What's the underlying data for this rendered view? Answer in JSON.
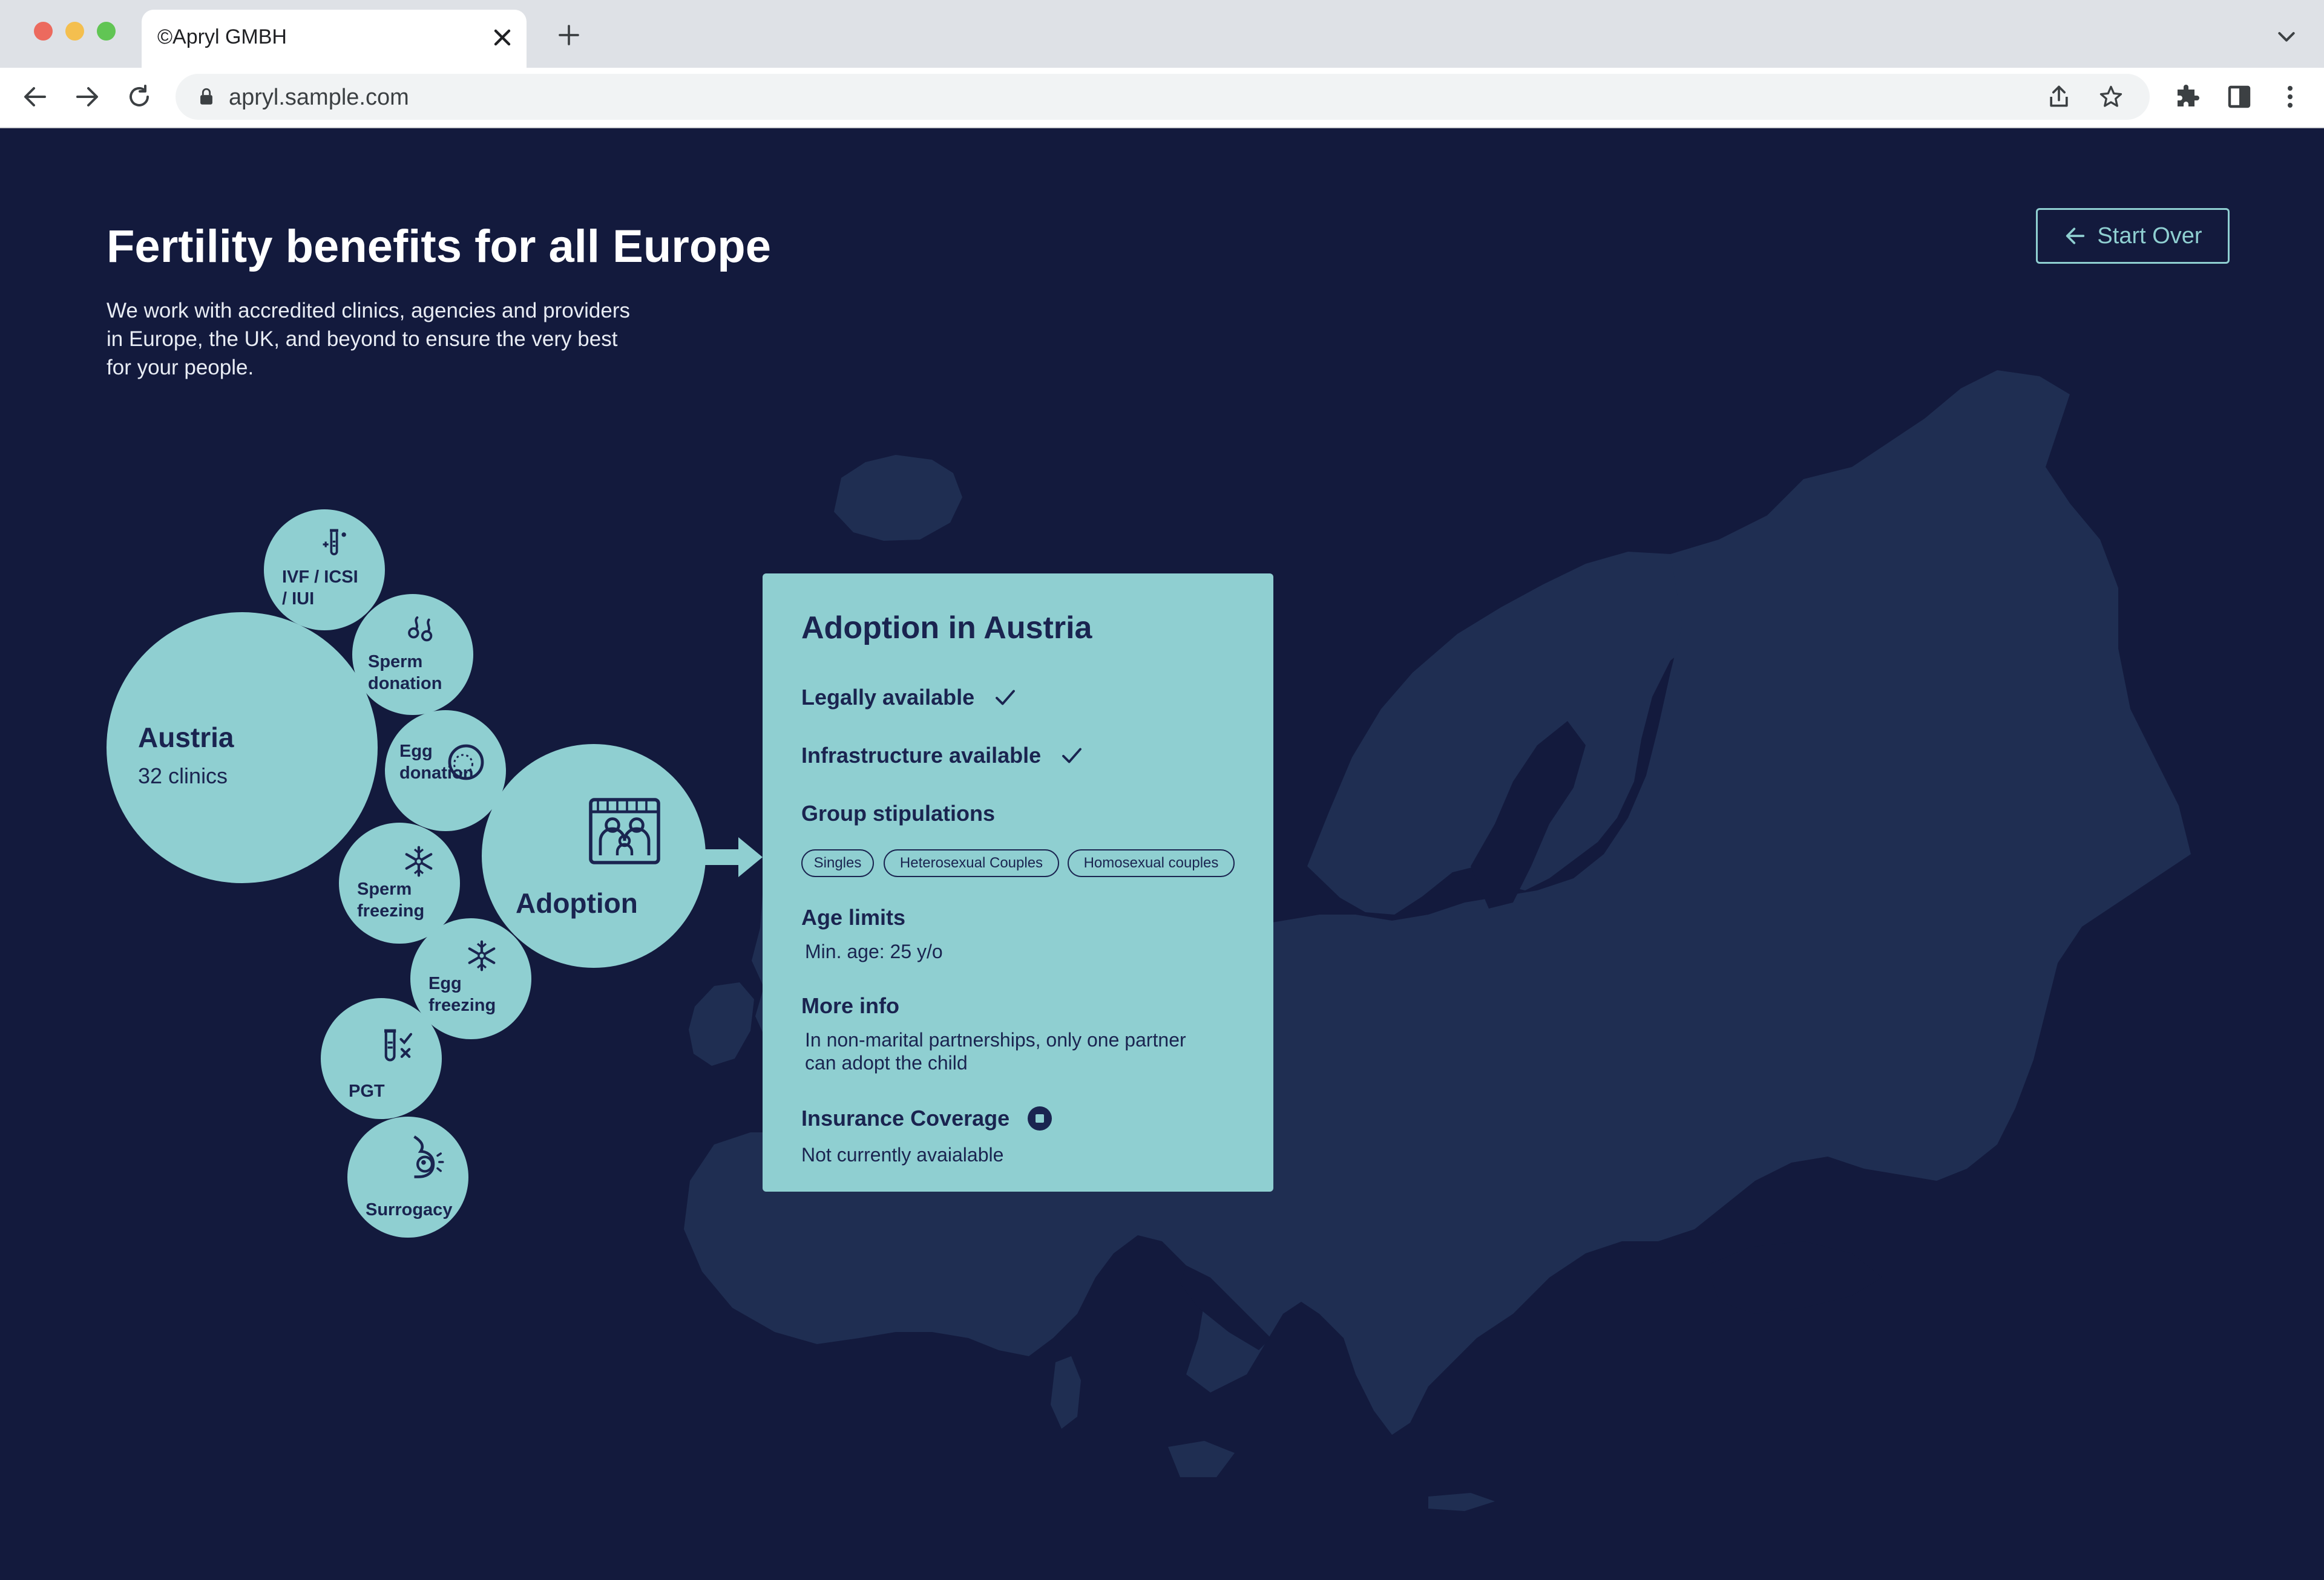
{
  "browser": {
    "tab_title": "©Apryl GMBH",
    "url": "apryl.sample.com"
  },
  "page": {
    "title": "Fertility benefits for all Europe",
    "subtitle_lines": [
      "We work with accredited clinics, agencies and providers",
      "in Europe, the UK, and beyond to ensure the very best",
      "for your people."
    ],
    "start_over_label": "Start Over"
  },
  "country": {
    "name": "Austria",
    "clinics": "32 clinics"
  },
  "services": [
    {
      "lines": [
        "IVF / ICSI",
        "/ IUI"
      ],
      "icon": "test-tube-icon"
    },
    {
      "lines": [
        "Sperm",
        "donation"
      ],
      "icon": "sperm-icon"
    },
    {
      "lines": [
        "Egg",
        "donation"
      ],
      "icon": "egg-icon"
    },
    {
      "lines": [
        "Sperm",
        "freezing"
      ],
      "icon": "snowflake-icon"
    },
    {
      "lines": [
        "Egg",
        "freezing"
      ],
      "icon": "snowflake-icon"
    },
    {
      "lines": [
        "PGT"
      ],
      "icon": "test-tube-check-icon"
    },
    {
      "lines": [
        "Surrogacy"
      ],
      "icon": "pregnancy-icon"
    }
  ],
  "selected_service": {
    "label": "Adoption",
    "icon": "family-frame-icon"
  },
  "detail_card": {
    "title": "Adoption in Austria",
    "legally_available": "Legally available",
    "infrastructure_available": "Infrastructure available",
    "group_stipulations_label": "Group stipulations",
    "groups": [
      "Singles",
      "Heterosexual Couples",
      "Homosexual couples"
    ],
    "age_limits_label": "Age limits",
    "age_limits_value": "Min. age: 25 y/o",
    "more_info_label": "More info",
    "more_info_lines": [
      "In non-marital partnerships, only one partner",
      "can adopt the child"
    ],
    "insurance_label": "Insurance Coverage",
    "insurance_value": "Not currently avaialable"
  },
  "colors": {
    "background": "#131a3d",
    "map": "#1f2e52",
    "accent": "#8fcfd1",
    "ink": "#1a2450"
  }
}
